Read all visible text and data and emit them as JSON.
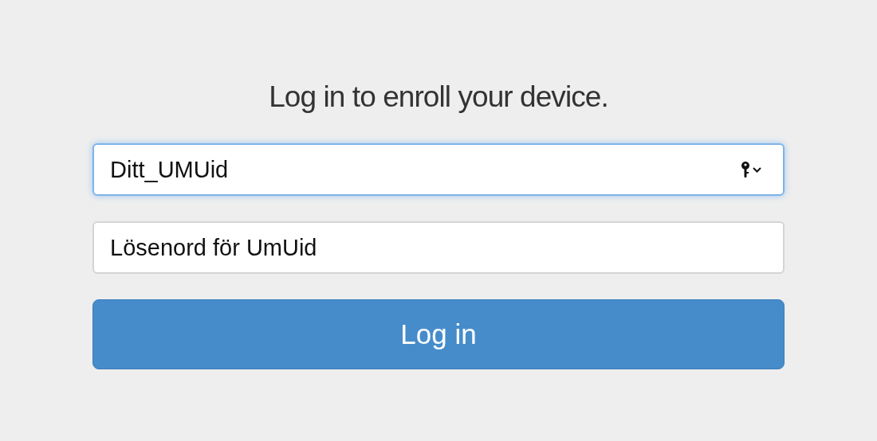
{
  "heading": "Log in to enroll your device.",
  "fields": [
    {
      "kind": "username",
      "placeholder": "Ditt_UMUid",
      "focused": true
    },
    {
      "kind": "password",
      "placeholder": "Lösenord för UmUid",
      "focused": false
    }
  ],
  "button": {
    "label": "Log in"
  }
}
